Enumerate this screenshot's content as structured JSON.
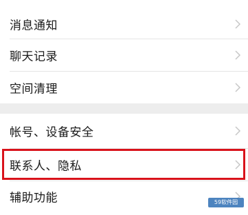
{
  "settings": {
    "items": [
      {
        "label": "消息通知",
        "icon": "chevron-right-icon"
      },
      {
        "label": "聊天记录",
        "icon": "chevron-right-icon"
      },
      {
        "label": "空间清理",
        "icon": "chevron-right-icon"
      },
      {
        "label": "帐号、设备安全",
        "icon": "chevron-right-icon"
      },
      {
        "label": "联系人、隐私",
        "icon": "chevron-right-icon"
      },
      {
        "label": "辅助功能",
        "icon": "chevron-right-icon"
      }
    ]
  },
  "highlight": {
    "color": "#d9121b",
    "target": "联系人、隐私"
  },
  "watermark": {
    "text": "59软件园"
  }
}
